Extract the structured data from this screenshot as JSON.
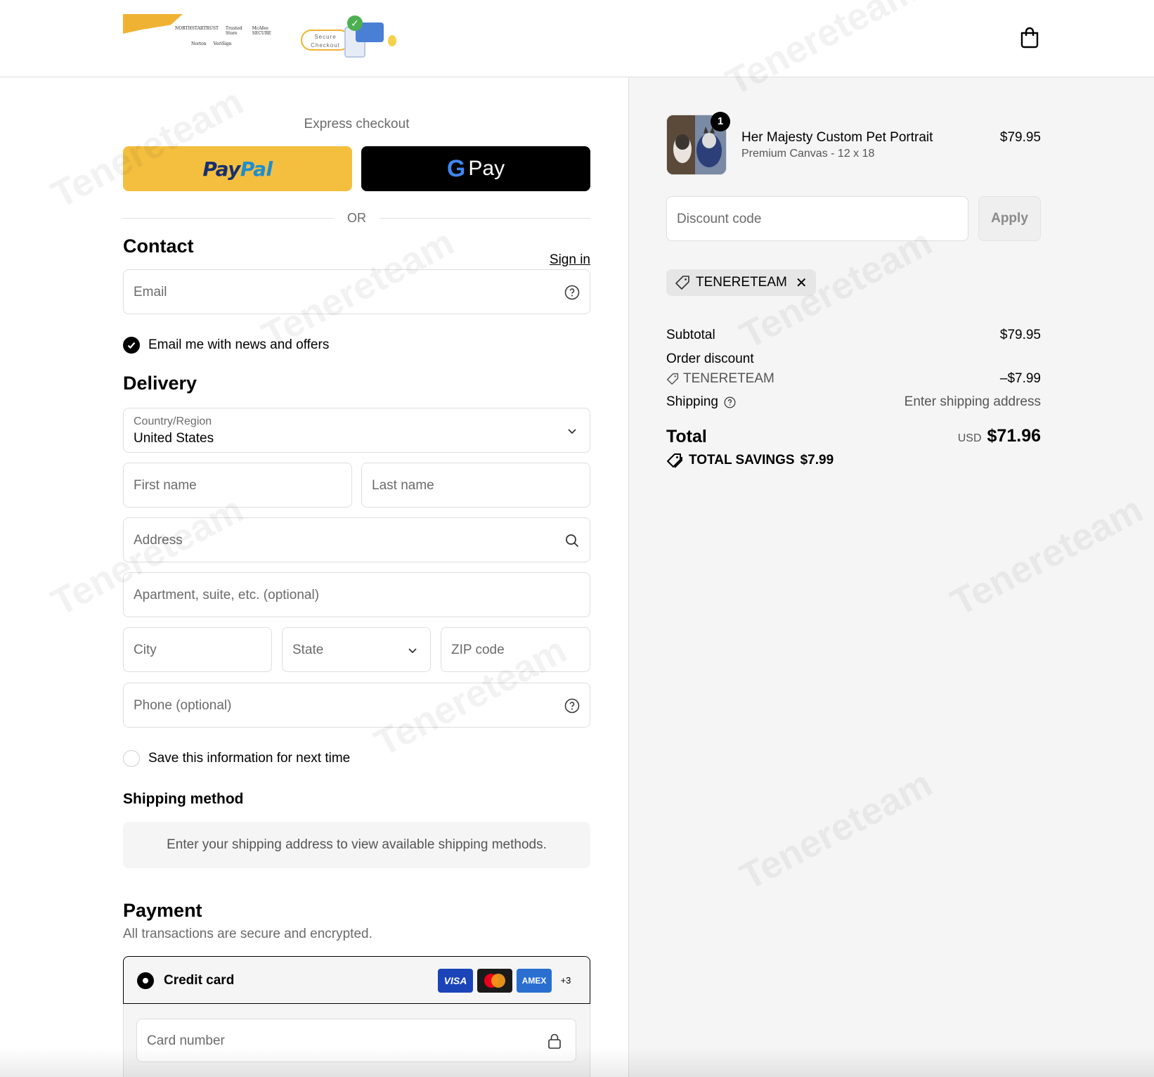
{
  "header": {
    "badges_text": [
      "NORTHSTARTRUST",
      "Trusted Store",
      "McAfee SECURE",
      "Norton",
      "VeriSign"
    ],
    "secure_checkout_text": "Secure Checkout",
    "cart_icon": "shopping-bag-icon"
  },
  "express": {
    "label": "Express checkout",
    "paypal_a": "Pay",
    "paypal_b": "Pal",
    "gpay_g": "G",
    "gpay_text": "Pay",
    "or": "OR"
  },
  "contact": {
    "title": "Contact",
    "sign_in": "Sign in",
    "email_placeholder": "Email",
    "email_opt_in": "Email me with news and offers",
    "email_opt_in_checked": true
  },
  "delivery": {
    "title": "Delivery",
    "country_label": "Country/Region",
    "country_value": "United States",
    "first_name": "First name",
    "last_name": "Last name",
    "address": "Address",
    "apartment": "Apartment, suite, etc. (optional)",
    "city": "City",
    "state": "State",
    "zip": "ZIP code",
    "phone": "Phone (optional)",
    "save_info": "Save this information for next time",
    "save_info_checked": false
  },
  "shipping_method": {
    "title": "Shipping method",
    "notice": "Enter your shipping address to view available shipping methods."
  },
  "payment": {
    "title": "Payment",
    "subtitle": "All transactions are secure and encrypted.",
    "credit_card_label": "Credit card",
    "card_brands": [
      "VISA",
      "Mastercard",
      "AMEX"
    ],
    "more_cards": "+3",
    "card_number_placeholder": "Card number"
  },
  "summary": {
    "product": {
      "quantity": "1",
      "name": "Her Majesty Custom Pet Portrait",
      "variant": "Premium Canvas - 12 x 18",
      "price": "$79.95"
    },
    "discount_placeholder": "Discount code",
    "apply_label": "Apply",
    "applied_code": "TENERETEAM",
    "subtotal_label": "Subtotal",
    "subtotal_value": "$79.95",
    "order_discount_label": "Order discount",
    "order_discount_code": "TENERETEAM",
    "order_discount_value": "–$7.99",
    "shipping_label": "Shipping",
    "shipping_value": "Enter shipping address",
    "total_label": "Total",
    "total_currency": "USD",
    "total_value": "$71.96",
    "total_savings_label": "TOTAL SAVINGS",
    "total_savings_value": "$7.99"
  },
  "watermark": "Tenereteam",
  "colors": {
    "paypal_yellow": "#f4bf3f",
    "paypal_dark": "#17306e",
    "paypal_light": "#1d8ed0",
    "panel_bg": "#f5f5f5",
    "border": "#dedede"
  }
}
